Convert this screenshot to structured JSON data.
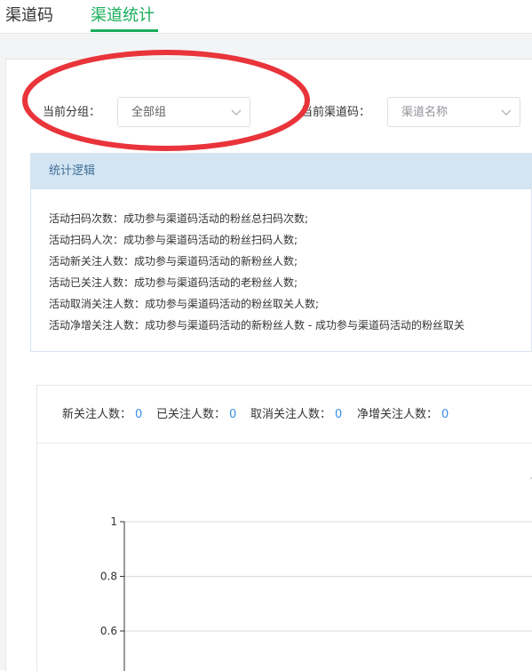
{
  "tabs": [
    {
      "label": "渠道码"
    },
    {
      "label": "渠道统计"
    }
  ],
  "filters": {
    "group_label": "当前分组：",
    "group_value": "全部组",
    "channel_label": "当前渠道码：",
    "channel_placeholder": "渠道名称"
  },
  "logic": {
    "title": "统计逻辑",
    "lines": [
      "活动扫码次数：成功参与渠道码活动的粉丝总扫码次数;",
      "活动扫码人次：成功参与渠道码活动的粉丝扫码人数;",
      "活动新关注人数：成功参与渠道码活动的新粉丝人数;",
      "活动已关注人数：成功参与渠道码活动的老粉丝人数;",
      "活动取消关注人数：成功参与渠道码活动的粉丝取关人数;",
      "活动净增关注人数：成功参与渠道码活动的新粉丝人数 - 成功参与渠道码活动的粉丝取关"
    ]
  },
  "stats": [
    {
      "label": "新关注人数：",
      "value": "0"
    },
    {
      "label": "已关注人数：",
      "value": "0"
    },
    {
      "label": "取消关注人数：",
      "value": "0"
    },
    {
      "label": "净增关注人数：",
      "value": "0"
    }
  ],
  "chart_data": {
    "type": "line",
    "title": "",
    "xlabel": "",
    "ylabel": "",
    "ylim": [
      0,
      1
    ],
    "yticks": [
      "1",
      "0.8",
      "0.6"
    ],
    "series": [],
    "grid": true
  },
  "annotation": {
    "color": "#e8343a",
    "shape": "ellipse"
  }
}
